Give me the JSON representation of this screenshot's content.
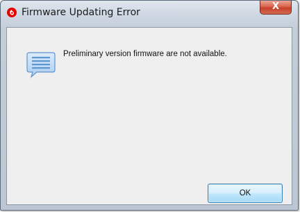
{
  "window": {
    "title": "Firmware Updating Error",
    "logo_icon": "vodafone-logo-icon",
    "close_label": "X"
  },
  "dialog": {
    "icon": "message-bubble-icon",
    "message": "Preliminary version firmware are not available.",
    "ok_label": "OK"
  },
  "colors": {
    "logo_red": "#e60000",
    "close_button": "#c7412a",
    "ok_border": "#3c7fb1",
    "client_background": "#efefef"
  }
}
